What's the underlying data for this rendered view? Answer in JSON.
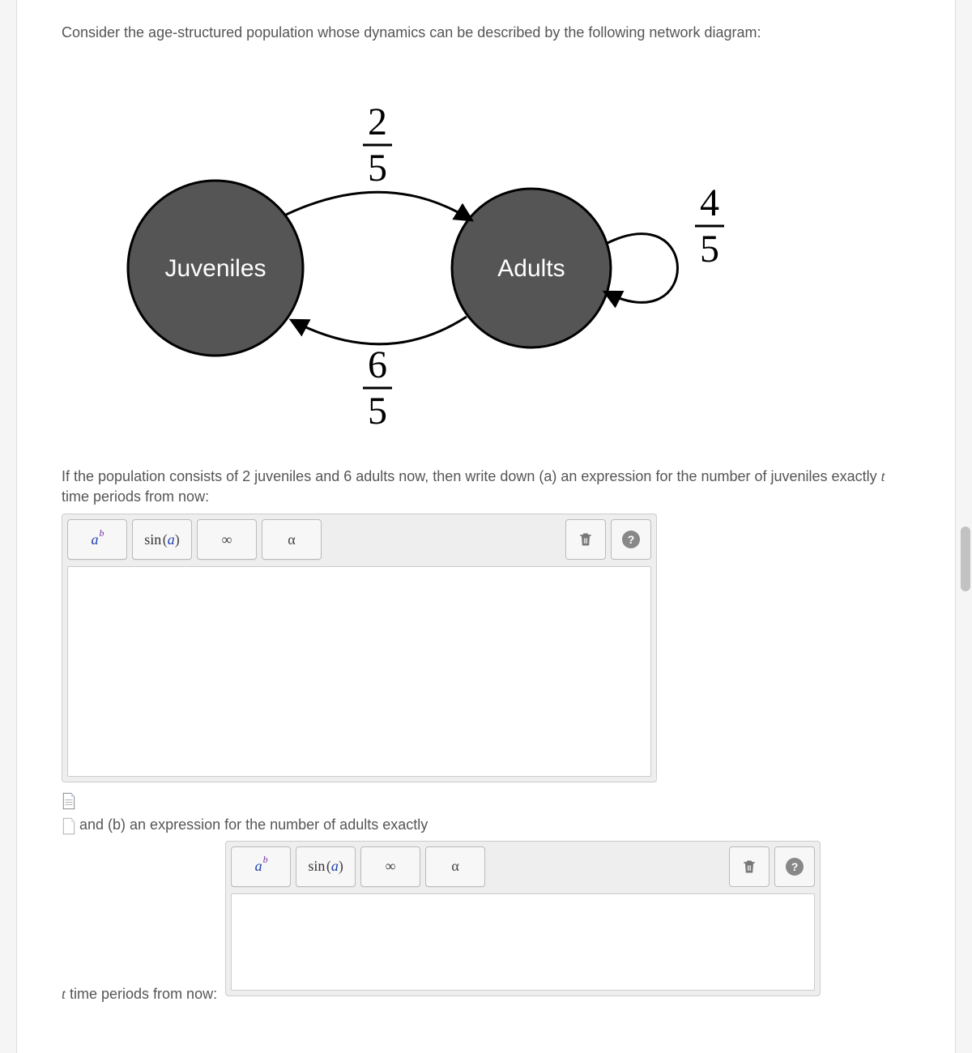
{
  "intro": "Consider the age-structured population whose dynamics can be described by the following network diagram:",
  "diagram": {
    "node1": "Juveniles",
    "node2": "Adults",
    "edge_juv_to_adult": {
      "num": "2",
      "den": "5"
    },
    "edge_adult_to_juv": {
      "num": "6",
      "den": "5"
    },
    "edge_adult_self": {
      "num": "4",
      "den": "5"
    }
  },
  "prompt_a_pre": "If the population consists of 2 juveniles and 6 adults now, then write down (a) an expression for the number of juveniles exactly ",
  "prompt_a_var": "t",
  "prompt_a_post": " time periods from now:",
  "prompt_b_pre": "and (b) an expression for the number of adults exactly",
  "prompt_b_tail_var": "t",
  "prompt_b_tail_post": " time periods from now:",
  "toolbar": {
    "ab_base": "a",
    "ab_sup": "b",
    "sin_fn": "sin",
    "sin_arg": "a",
    "infty": "∞",
    "alpha": "α"
  }
}
